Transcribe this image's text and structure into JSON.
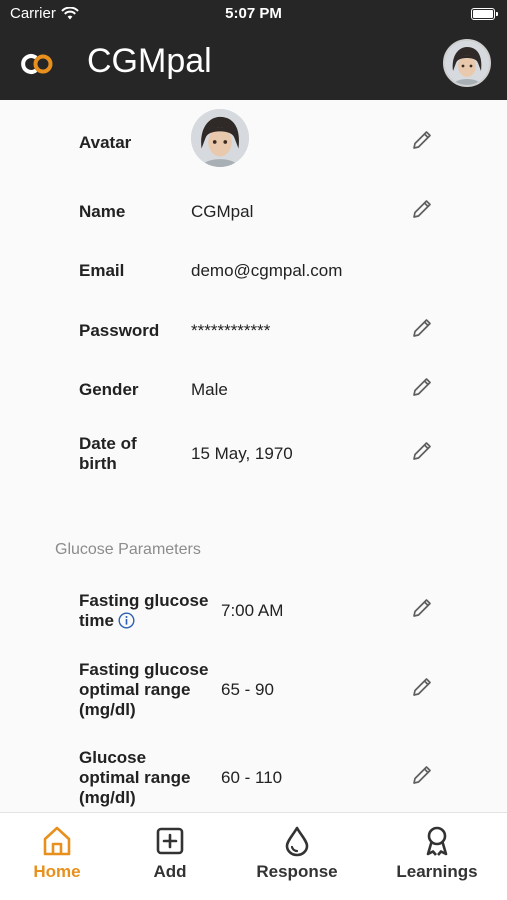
{
  "status_bar": {
    "carrier": "Carrier",
    "time": "5:07 PM"
  },
  "app": {
    "title": "CGMpal",
    "accent": "#e8901e",
    "header_bg": "#262626"
  },
  "profile": {
    "avatar_label": "Avatar",
    "name_label": "Name",
    "name_value": "CGMpal",
    "email_label": "Email",
    "email_value": "demo@cgmpal.com",
    "password_label": "Password",
    "password_value": "************",
    "gender_label": "Gender",
    "gender_value": "Male",
    "dob_label_line1": "Date of",
    "dob_label_line2": "birth",
    "dob_value": "15 May, 1970"
  },
  "glucose": {
    "section_title": "Glucose Parameters",
    "fasting_time_label_line1": "Fasting glucose",
    "fasting_time_label_line2": "time",
    "fasting_time_value": "7:00 AM",
    "fasting_range_label_line1": "Fasting glucose",
    "fasting_range_label_line2": "optimal range",
    "fasting_range_label_line3": "(mg/dl)",
    "fasting_range_value": "65 - 90",
    "optimal_range_label_line1": "Glucose",
    "optimal_range_label_line2": "optimal range",
    "optimal_range_label_line3": "(mg/dl)",
    "optimal_range_value": "60 - 110"
  },
  "icons": {
    "edit": "pencil-icon",
    "info": "info-icon",
    "home": "home-icon",
    "add": "plus-square-icon",
    "response": "drop-icon",
    "learnings": "ribbon-icon"
  },
  "tabs": [
    {
      "label": "Home",
      "active": true
    },
    {
      "label": "Add",
      "active": false
    },
    {
      "label": "Response",
      "active": false
    },
    {
      "label": "Learnings",
      "active": false
    }
  ]
}
